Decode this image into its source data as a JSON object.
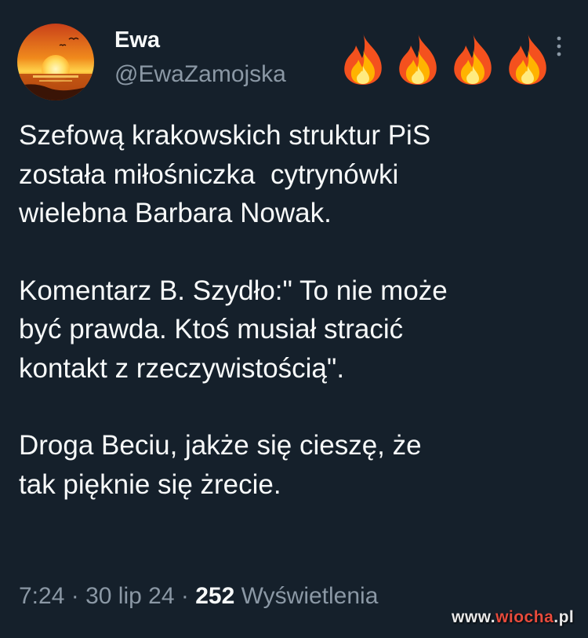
{
  "tweet": {
    "author": {
      "display_name": "Ewa",
      "handle": "@EwaZamojska",
      "avatar": "sunset-avatar"
    },
    "name_emoji": [
      "fire-icon",
      "fire-icon",
      "fire-icon",
      "fire-icon"
    ],
    "more_icon": "more-vertical-icon",
    "paragraphs": [
      "Szefową krakowskich struktur PiS\nzostała miłośniczka  cytrynówki\nwielebna Barbara Nowak.",
      "Komentarz B. Szydło:\" To nie może\nbyć prawda. Ktoś musiał stracić\nkontakt z rzeczywistością\".",
      "Droga Beciu, jakże się cieszę, że\ntak pięknie się żrecie."
    ],
    "meta": {
      "time": "7:24",
      "separator": "·",
      "date": "30 lip 24",
      "views_count": "252",
      "views_label": "Wyświetlenia"
    }
  },
  "watermark": {
    "prefix": "www.",
    "accent": "wiocha",
    "suffix": ".pl"
  },
  "colors": {
    "background": "#15202b",
    "text_primary": "#f7f9f9",
    "text_secondary": "#8b98a5"
  }
}
